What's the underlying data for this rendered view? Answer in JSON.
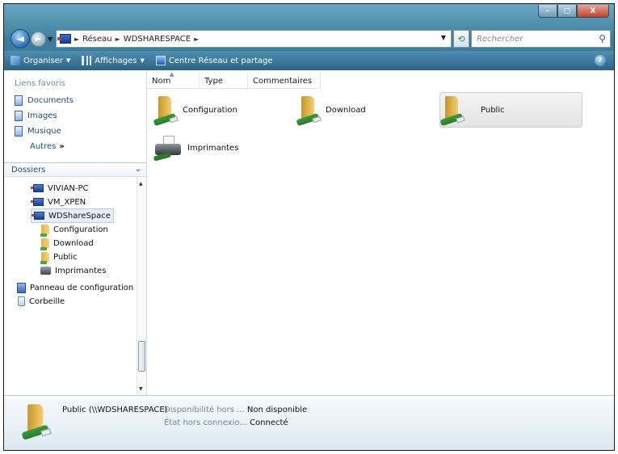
{
  "window": {
    "buttons": {
      "minimize": "–",
      "maximize": "□",
      "close": "X"
    }
  },
  "address": {
    "crumbs": [
      "Réseau",
      "WDSHARESPACE"
    ],
    "search_placeholder": "Rechercher"
  },
  "toolbar": {
    "organize": "Organiser",
    "views": "Affichages",
    "network_center": "Centre Réseau et partage",
    "help": "?"
  },
  "sidebar": {
    "favorites_title": "Liens favoris",
    "favorites": [
      "Documents",
      "Images",
      "Musique"
    ],
    "more": "Autres",
    "more_arrow": "»",
    "folders_title": "Dossiers",
    "tree": [
      {
        "label": "VIVIAN-PC",
        "icon": "network-computer-icon"
      },
      {
        "label": "VM_XPEN",
        "icon": "network-computer-icon"
      },
      {
        "label": "WDShareSpace",
        "icon": "network-computer-icon"
      },
      {
        "label": "Configuration",
        "icon": "shared-folder-icon"
      },
      {
        "label": "Download",
        "icon": "shared-folder-icon"
      },
      {
        "label": "Public",
        "icon": "shared-folder-icon"
      },
      {
        "label": "Imprimantes",
        "icon": "printer-icon"
      },
      {
        "label": "Panneau de configuration",
        "icon": "control-panel-icon"
      },
      {
        "label": "Corbeille",
        "icon": "recycle-bin-icon"
      }
    ]
  },
  "columns": [
    "Nom",
    "Type",
    "Commentaires"
  ],
  "items": [
    {
      "label": "Configuration",
      "icon": "shared-folder-icon"
    },
    {
      "label": "Download",
      "icon": "shared-folder-icon"
    },
    {
      "label": "Public",
      "icon": "shared-folder-icon",
      "selected": true
    },
    {
      "label": "Imprimantes",
      "icon": "printer-icon"
    }
  ],
  "details": {
    "name": "Public (\\\\WDSHARESPACE)",
    "fields": [
      {
        "label": "Disponibilité hors ...",
        "value": "Non disponible"
      },
      {
        "label": "État hors connexio...",
        "value": "Connecté"
      }
    ]
  },
  "colors": {
    "chrome": "#2f6f8c",
    "toolbar": "#2b6384",
    "link": "#1e4c8f",
    "selection": "#e4e4e4"
  }
}
